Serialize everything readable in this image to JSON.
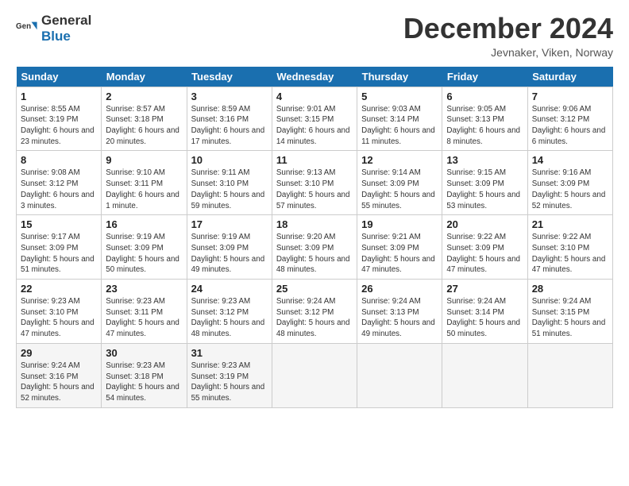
{
  "logo": {
    "line1": "General",
    "line2": "Blue"
  },
  "header": {
    "month": "December 2024",
    "location": "Jevnaker, Viken, Norway"
  },
  "days_of_week": [
    "Sunday",
    "Monday",
    "Tuesday",
    "Wednesday",
    "Thursday",
    "Friday",
    "Saturday"
  ],
  "weeks": [
    [
      {
        "day": "1",
        "sunrise": "Sunrise: 8:55 AM",
        "sunset": "Sunset: 3:19 PM",
        "daylight": "Daylight: 6 hours and 23 minutes."
      },
      {
        "day": "2",
        "sunrise": "Sunrise: 8:57 AM",
        "sunset": "Sunset: 3:18 PM",
        "daylight": "Daylight: 6 hours and 20 minutes."
      },
      {
        "day": "3",
        "sunrise": "Sunrise: 8:59 AM",
        "sunset": "Sunset: 3:16 PM",
        "daylight": "Daylight: 6 hours and 17 minutes."
      },
      {
        "day": "4",
        "sunrise": "Sunrise: 9:01 AM",
        "sunset": "Sunset: 3:15 PM",
        "daylight": "Daylight: 6 hours and 14 minutes."
      },
      {
        "day": "5",
        "sunrise": "Sunrise: 9:03 AM",
        "sunset": "Sunset: 3:14 PM",
        "daylight": "Daylight: 6 hours and 11 minutes."
      },
      {
        "day": "6",
        "sunrise": "Sunrise: 9:05 AM",
        "sunset": "Sunset: 3:13 PM",
        "daylight": "Daylight: 6 hours and 8 minutes."
      },
      {
        "day": "7",
        "sunrise": "Sunrise: 9:06 AM",
        "sunset": "Sunset: 3:12 PM",
        "daylight": "Daylight: 6 hours and 6 minutes."
      }
    ],
    [
      {
        "day": "8",
        "sunrise": "Sunrise: 9:08 AM",
        "sunset": "Sunset: 3:12 PM",
        "daylight": "Daylight: 6 hours and 3 minutes."
      },
      {
        "day": "9",
        "sunrise": "Sunrise: 9:10 AM",
        "sunset": "Sunset: 3:11 PM",
        "daylight": "Daylight: 6 hours and 1 minute."
      },
      {
        "day": "10",
        "sunrise": "Sunrise: 9:11 AM",
        "sunset": "Sunset: 3:10 PM",
        "daylight": "Daylight: 5 hours and 59 minutes."
      },
      {
        "day": "11",
        "sunrise": "Sunrise: 9:13 AM",
        "sunset": "Sunset: 3:10 PM",
        "daylight": "Daylight: 5 hours and 57 minutes."
      },
      {
        "day": "12",
        "sunrise": "Sunrise: 9:14 AM",
        "sunset": "Sunset: 3:09 PM",
        "daylight": "Daylight: 5 hours and 55 minutes."
      },
      {
        "day": "13",
        "sunrise": "Sunrise: 9:15 AM",
        "sunset": "Sunset: 3:09 PM",
        "daylight": "Daylight: 5 hours and 53 minutes."
      },
      {
        "day": "14",
        "sunrise": "Sunrise: 9:16 AM",
        "sunset": "Sunset: 3:09 PM",
        "daylight": "Daylight: 5 hours and 52 minutes."
      }
    ],
    [
      {
        "day": "15",
        "sunrise": "Sunrise: 9:17 AM",
        "sunset": "Sunset: 3:09 PM",
        "daylight": "Daylight: 5 hours and 51 minutes."
      },
      {
        "day": "16",
        "sunrise": "Sunrise: 9:19 AM",
        "sunset": "Sunset: 3:09 PM",
        "daylight": "Daylight: 5 hours and 50 minutes."
      },
      {
        "day": "17",
        "sunrise": "Sunrise: 9:19 AM",
        "sunset": "Sunset: 3:09 PM",
        "daylight": "Daylight: 5 hours and 49 minutes."
      },
      {
        "day": "18",
        "sunrise": "Sunrise: 9:20 AM",
        "sunset": "Sunset: 3:09 PM",
        "daylight": "Daylight: 5 hours and 48 minutes."
      },
      {
        "day": "19",
        "sunrise": "Sunrise: 9:21 AM",
        "sunset": "Sunset: 3:09 PM",
        "daylight": "Daylight: 5 hours and 47 minutes."
      },
      {
        "day": "20",
        "sunrise": "Sunrise: 9:22 AM",
        "sunset": "Sunset: 3:09 PM",
        "daylight": "Daylight: 5 hours and 47 minutes."
      },
      {
        "day": "21",
        "sunrise": "Sunrise: 9:22 AM",
        "sunset": "Sunset: 3:10 PM",
        "daylight": "Daylight: 5 hours and 47 minutes."
      }
    ],
    [
      {
        "day": "22",
        "sunrise": "Sunrise: 9:23 AM",
        "sunset": "Sunset: 3:10 PM",
        "daylight": "Daylight: 5 hours and 47 minutes."
      },
      {
        "day": "23",
        "sunrise": "Sunrise: 9:23 AM",
        "sunset": "Sunset: 3:11 PM",
        "daylight": "Daylight: 5 hours and 47 minutes."
      },
      {
        "day": "24",
        "sunrise": "Sunrise: 9:23 AM",
        "sunset": "Sunset: 3:12 PM",
        "daylight": "Daylight: 5 hours and 48 minutes."
      },
      {
        "day": "25",
        "sunrise": "Sunrise: 9:24 AM",
        "sunset": "Sunset: 3:12 PM",
        "daylight": "Daylight: 5 hours and 48 minutes."
      },
      {
        "day": "26",
        "sunrise": "Sunrise: 9:24 AM",
        "sunset": "Sunset: 3:13 PM",
        "daylight": "Daylight: 5 hours and 49 minutes."
      },
      {
        "day": "27",
        "sunrise": "Sunrise: 9:24 AM",
        "sunset": "Sunset: 3:14 PM",
        "daylight": "Daylight: 5 hours and 50 minutes."
      },
      {
        "day": "28",
        "sunrise": "Sunrise: 9:24 AM",
        "sunset": "Sunset: 3:15 PM",
        "daylight": "Daylight: 5 hours and 51 minutes."
      }
    ],
    [
      {
        "day": "29",
        "sunrise": "Sunrise: 9:24 AM",
        "sunset": "Sunset: 3:16 PM",
        "daylight": "Daylight: 5 hours and 52 minutes."
      },
      {
        "day": "30",
        "sunrise": "Sunrise: 9:23 AM",
        "sunset": "Sunset: 3:18 PM",
        "daylight": "Daylight: 5 hours and 54 minutes."
      },
      {
        "day": "31",
        "sunrise": "Sunrise: 9:23 AM",
        "sunset": "Sunset: 3:19 PM",
        "daylight": "Daylight: 5 hours and 55 minutes."
      },
      null,
      null,
      null,
      null
    ]
  ]
}
